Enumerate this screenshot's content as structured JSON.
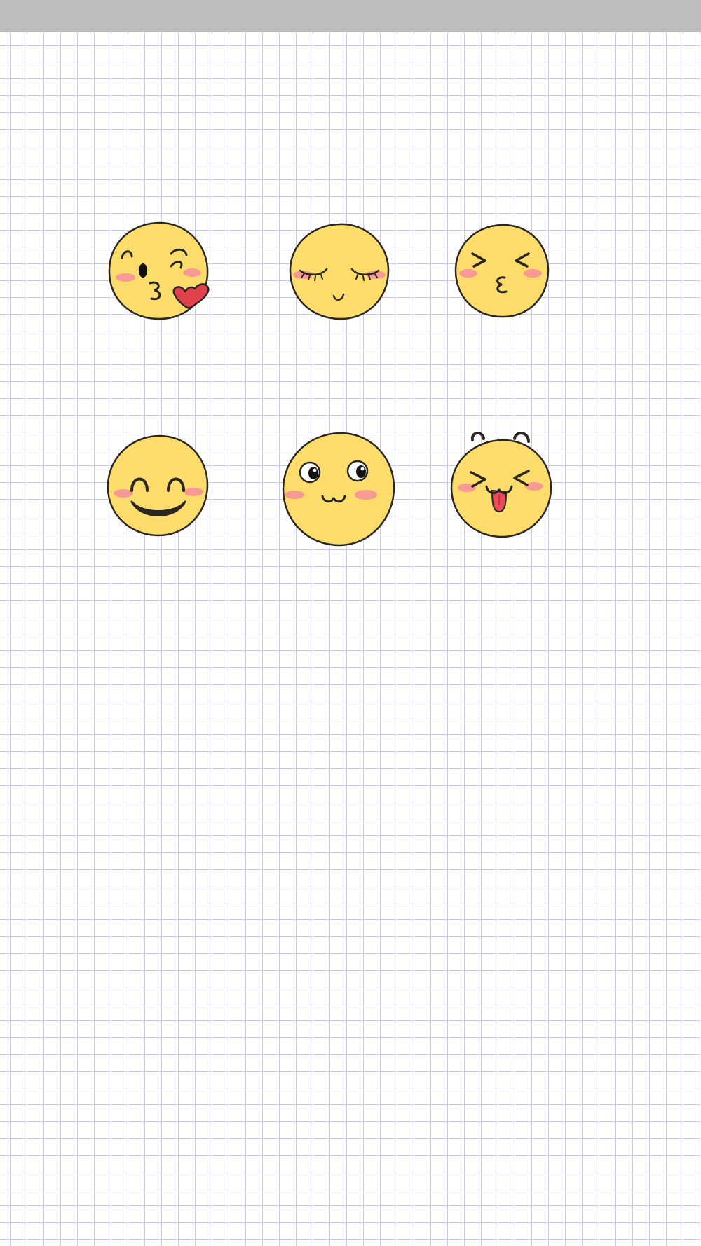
{
  "colors": {
    "status_bar": "#bdbdbd",
    "grid_line": "#cdcadb",
    "face_fill": "#fcdc6a",
    "face_outline": "#2a2622",
    "blush": "#f48a9e",
    "heart": "#e0414a",
    "tongue": "#e84b5c"
  },
  "stickers": [
    {
      "icon": "blowing-kiss-emoji-icon"
    },
    {
      "icon": "content-closed-eyes-emoji-icon"
    },
    {
      "icon": "squinting-kiss-emoji-icon"
    },
    {
      "icon": "happy-smile-emoji-icon"
    },
    {
      "icon": "shy-wide-eyes-emoji-icon"
    },
    {
      "icon": "laughing-tongue-out-emoji-icon"
    }
  ]
}
